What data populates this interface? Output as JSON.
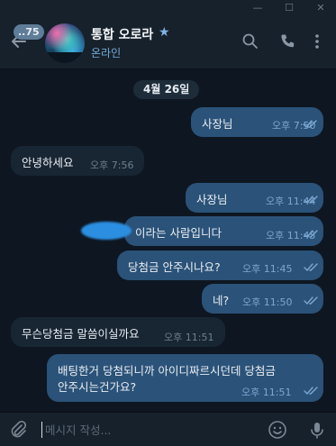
{
  "window": {
    "minimize": "—",
    "maximize": "☐",
    "close": "✕"
  },
  "header": {
    "unread_badge": "..75",
    "chat_name": "통합 오로라",
    "status": "온라인"
  },
  "date_label": "4월 26일",
  "messages": [
    {
      "dir": "out",
      "text": "사장님",
      "time": "오후 7:50"
    },
    {
      "dir": "in",
      "text": "안녕하세요",
      "time": "오후 7:56"
    },
    {
      "dir": "out",
      "text": "사장님",
      "time": "오후 11:44"
    },
    {
      "dir": "out",
      "text": "이라는 사람입니다",
      "time": "오후 11:45"
    },
    {
      "dir": "out",
      "text": "당첨금 안주시나요?",
      "time": "오후 11:45"
    },
    {
      "dir": "out",
      "text": "네?",
      "time": "오후 11:50"
    },
    {
      "dir": "in",
      "text": "무슨당첨금 말씀이실까요",
      "time": "오후 11:51"
    },
    {
      "dir": "out",
      "text_line1": "배팅한거 당첨되니까 아이디짜르시던데 당첨금",
      "text_line2": "안주시는건가요?",
      "time": "오후 11:51"
    }
  ],
  "composer": {
    "placeholder": "메시지 작성..."
  },
  "colors": {
    "background": "#0e1621",
    "outgoing": "#2b5278",
    "incoming": "#182533",
    "accent": "#74a9d6"
  }
}
